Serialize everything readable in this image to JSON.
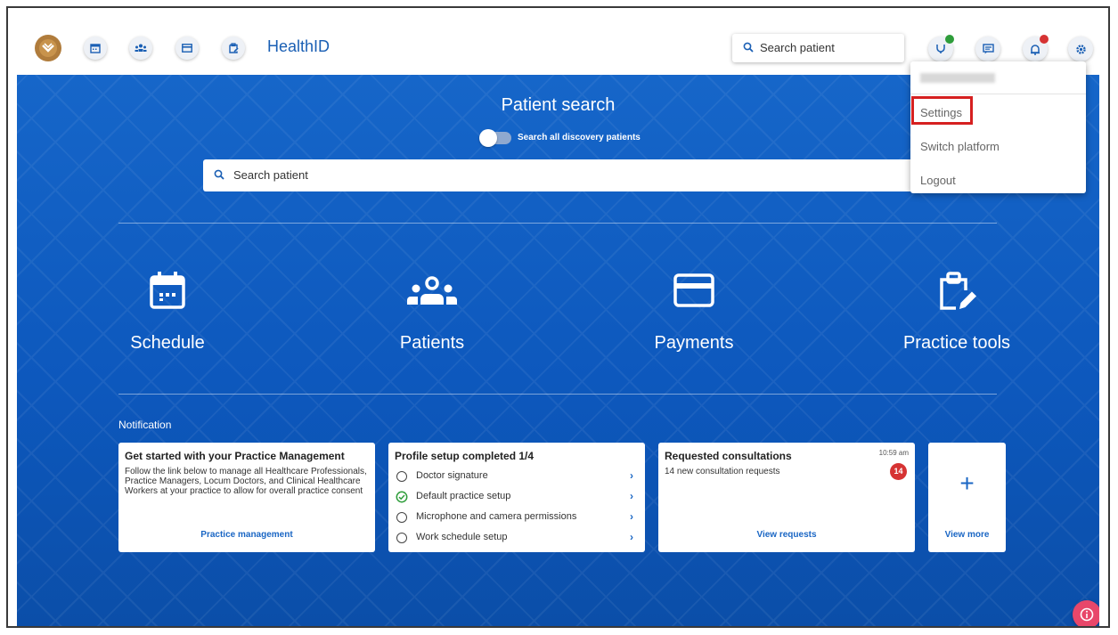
{
  "header": {
    "brand": "HealthID",
    "search_placeholder": "Search patient"
  },
  "main": {
    "title": "Patient search",
    "toggle_label": "Search all discovery patients",
    "search_placeholder": "Search patient",
    "tiles": [
      {
        "label": "Schedule",
        "icon": "calendar-icon"
      },
      {
        "label": "Patients",
        "icon": "people-icon"
      },
      {
        "label": "Payments",
        "icon": "card-icon"
      },
      {
        "label": "Practice tools",
        "icon": "clipboard-edit-icon"
      }
    ],
    "notification_title": "Notification"
  },
  "cards": {
    "practice": {
      "title": "Get started with your Practice Management",
      "body": "Follow the link below to manage all Healthcare Professionals, Practice Managers, Locum Doctors, and Clinical Healthcare Workers at your practice to allow for overall practice consent",
      "link": "Practice management"
    },
    "profile": {
      "title": "Profile setup completed 1/4",
      "items": [
        {
          "label": "Doctor signature",
          "done": false
        },
        {
          "label": "Default practice setup",
          "done": true
        },
        {
          "label": "Microphone and camera permissions",
          "done": false
        },
        {
          "label": "Work schedule setup",
          "done": false
        }
      ]
    },
    "consultations": {
      "title": "Requested consultations",
      "time": "10:59 am",
      "body": "14 new consultation requests",
      "badge": "14",
      "link": "View requests"
    },
    "more": {
      "link": "View more"
    }
  },
  "menu": {
    "items": [
      "Settings",
      "Switch platform",
      "Logout"
    ]
  },
  "colors": {
    "primary": "#1a66c4",
    "hero": "#0d58bd",
    "highlight": "#d62020",
    "notification_dot": "#d63333",
    "status_dot": "#2e9d3a",
    "fab": "#e8476a"
  }
}
